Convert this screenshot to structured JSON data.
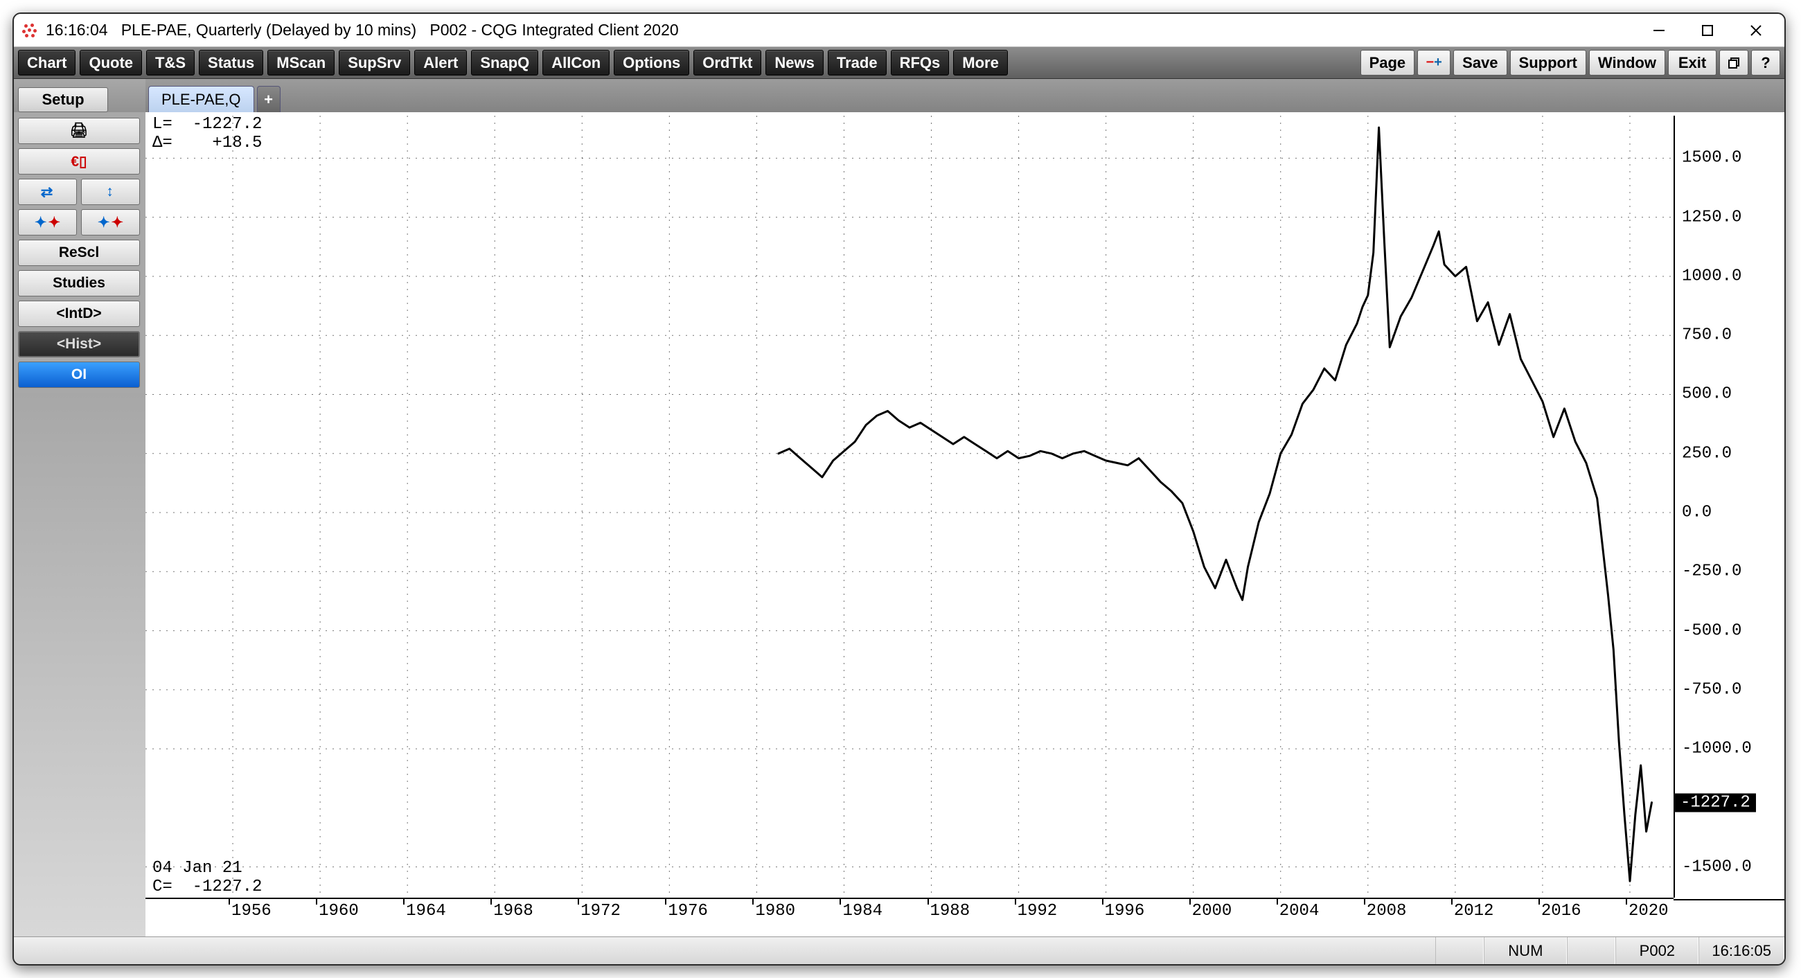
{
  "title": {
    "clock": "16:16:04",
    "symbol_desc": "PLE-PAE, Quarterly (Delayed by 10 mins)",
    "app": "P002 - CQG Integrated Client 2020"
  },
  "main_toolbar": {
    "left": [
      "Chart",
      "Quote",
      "T&S",
      "Status",
      "MScan",
      "SupSrv",
      "Alert",
      "SnapQ",
      "AllCon",
      "Options",
      "OrdTkt",
      "News",
      "Trade",
      "RFQs",
      "More"
    ],
    "right": {
      "page": "Page",
      "save": "Save",
      "support": "Support",
      "window": "Window",
      "exit": "Exit"
    }
  },
  "side": {
    "setup": "Setup",
    "rescl": "ReScl",
    "studies": "Studies",
    "intd": "<IntD>",
    "hist": "<Hist>",
    "oi": "OI"
  },
  "page_tab": "PLE-PAE,Q",
  "overlay_top": "L=  -1227.2\nΔ=    +18.5",
  "overlay_bottom": "04 Jan 21\nC=  -1227.2",
  "status": {
    "num": "NUM",
    "p002": "P002",
    "clock": "16:16:05"
  },
  "chart_data": {
    "type": "line",
    "title": "",
    "xlabel": "",
    "ylabel": "",
    "y_ticks": [
      1500,
      1250,
      1000,
      750,
      500,
      250,
      0,
      -250,
      -500,
      -750,
      -1000,
      -1500
    ],
    "y_current": -1227.2,
    "ylim": [
      -1630,
      1680
    ],
    "x_ticks": [
      1956,
      1960,
      1964,
      1968,
      1972,
      1976,
      1980,
      1984,
      1988,
      1992,
      1996,
      2000,
      2004,
      2008,
      2012,
      2016,
      2020
    ],
    "xlim": [
      1952,
      2022
    ],
    "series": [
      {
        "name": "PLE-PAE",
        "x": [
          1981.0,
          1981.5,
          1982.0,
          1982.5,
          1983.0,
          1983.5,
          1984.0,
          1984.5,
          1985.0,
          1985.5,
          1986.0,
          1986.5,
          1987.0,
          1987.5,
          1988.0,
          1988.5,
          1989.0,
          1989.5,
          1990.0,
          1990.5,
          1991.0,
          1991.5,
          1992.0,
          1992.5,
          1993.0,
          1993.5,
          1994.0,
          1994.5,
          1995.0,
          1995.5,
          1996.0,
          1996.5,
          1997.0,
          1997.5,
          1998.0,
          1998.5,
          1999.0,
          1999.5,
          2000.0,
          2000.5,
          2001.0,
          2001.5,
          2002.0,
          2002.25,
          2002.5,
          2003.0,
          2003.5,
          2004.0,
          2004.5,
          2005.0,
          2005.5,
          2006.0,
          2006.5,
          2007.0,
          2007.5,
          2007.75,
          2008.0,
          2008.25,
          2008.5,
          2008.75,
          2009.0,
          2009.5,
          2010.0,
          2010.5,
          2011.0,
          2011.25,
          2011.5,
          2012.0,
          2012.5,
          2013.0,
          2013.5,
          2014.0,
          2014.5,
          2015.0,
          2015.5,
          2016.0,
          2016.5,
          2017.0,
          2017.5,
          2018.0,
          2018.5,
          2019.0,
          2019.25,
          2019.5,
          2019.75,
          2020.0,
          2020.25,
          2020.5,
          2020.75,
          2021.0
        ],
        "values": [
          250,
          270,
          230,
          190,
          150,
          220,
          260,
          300,
          370,
          410,
          430,
          390,
          360,
          380,
          350,
          320,
          290,
          320,
          290,
          260,
          230,
          260,
          230,
          240,
          260,
          250,
          230,
          250,
          260,
          240,
          220,
          210,
          200,
          230,
          180,
          130,
          90,
          40,
          -80,
          -230,
          -320,
          -200,
          -320,
          -370,
          -230,
          -40,
          80,
          250,
          330,
          460,
          520,
          610,
          560,
          710,
          800,
          870,
          920,
          1100,
          1630,
          1150,
          700,
          830,
          910,
          1020,
          1130,
          1190,
          1050,
          1000,
          1040,
          810,
          890,
          710,
          840,
          650,
          560,
          470,
          320,
          440,
          300,
          210,
          60,
          -350,
          -580,
          -970,
          -1280,
          -1560,
          -1280,
          -1070,
          -1350,
          -1227.2
        ]
      }
    ]
  }
}
